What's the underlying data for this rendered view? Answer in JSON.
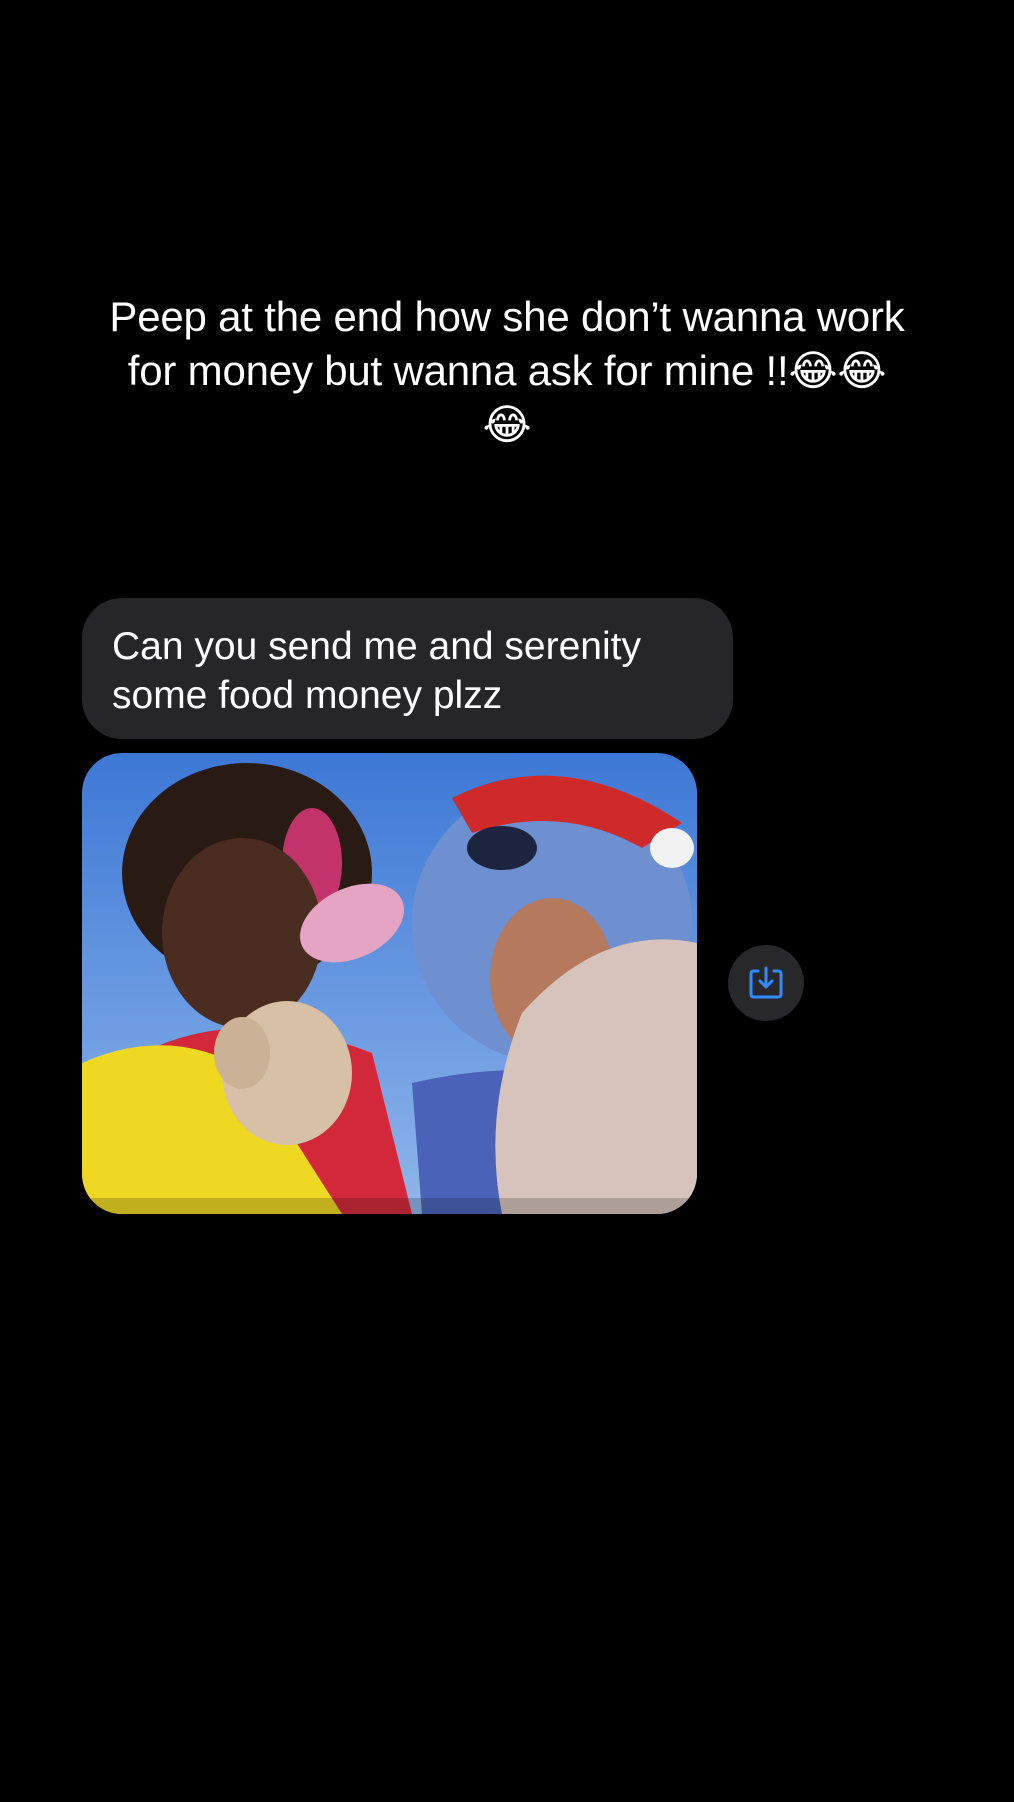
{
  "caption": {
    "text": "Peep at the end how she don’t wanna work for money but wanna ask for mine !!😂😂😂"
  },
  "message": {
    "text": "Can you send me and serenity some food money plzz"
  },
  "attachment": {
    "kind": "photo",
    "save_icon": "save-to-device-icon"
  },
  "colors": {
    "background": "#000000",
    "bubble": "#262628",
    "accent": "#2f8cff"
  }
}
